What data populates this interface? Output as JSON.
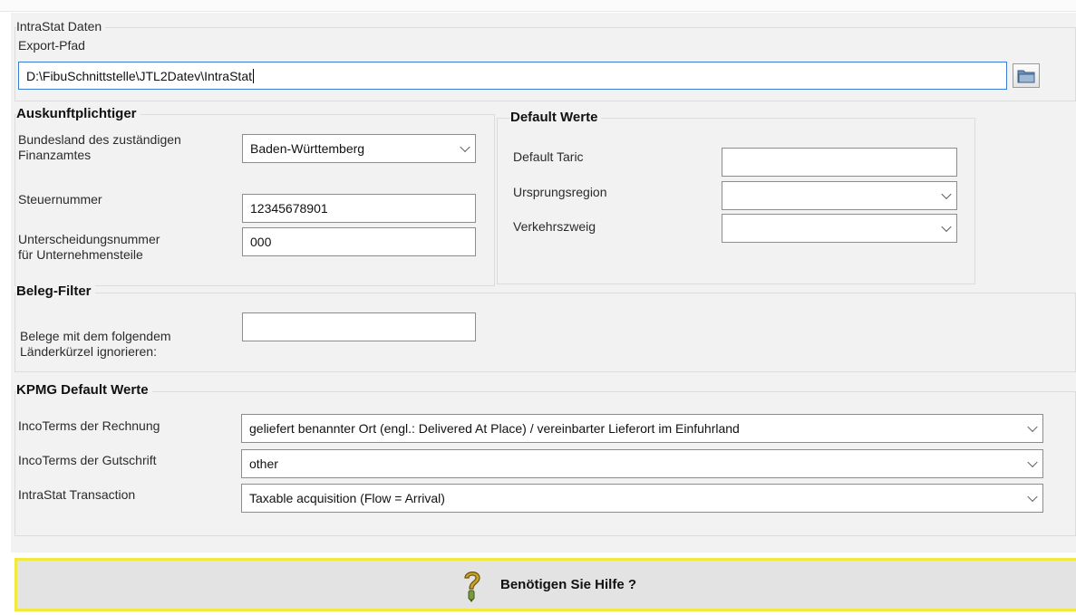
{
  "intrastat": {
    "title": "IntraStat Daten",
    "export_label": "Export-Pfad",
    "export_path": "D:\\FibuSchnittstelle\\JTL2Datev\\IntraStat"
  },
  "auskunft": {
    "title": "Auskunftplichtiger",
    "bundesland_label1": "Bundesland des zuständigen",
    "bundesland_label2": "Finanzamtes",
    "bundesland_value": "Baden-Württemberg",
    "steuernummer_label": "Steuernummer",
    "steuernummer_value": "12345678901",
    "unterscheidung_label1": "Unterscheidungsnummer",
    "unterscheidung_label2": "für Unternehmensteile",
    "unterscheidung_value": "000"
  },
  "default_werte": {
    "title": "Default Werte",
    "taric_label": "Default Taric",
    "taric_value": "",
    "ursprung_label": "Ursprungsregion",
    "ursprung_value": "",
    "verkehr_label": "Verkehrszweig",
    "verkehr_value": ""
  },
  "beleg_filter": {
    "title": "Beleg-Filter",
    "label1": "Belege mit dem folgendem",
    "label2": "Länderkürzel ignorieren:",
    "value": ""
  },
  "kpmg": {
    "title": "KPMG Default Werte",
    "rechnung_label": "IncoTerms der Rechnung",
    "rechnung_value": "geliefert benannter Ort (engl.: Delivered At Place) / vereinbarter Lieferort im Einfuhrland",
    "gutschrift_label": "IncoTerms der Gutschrift",
    "gutschrift_value": "other",
    "transaction_label": "IntraStat Transaction",
    "transaction_value": "Taxable acquisition (Flow = Arrival)"
  },
  "help_button": {
    "label": "Benötigen Sie Hilfe ?"
  },
  "icons": {
    "folder": "folder-icon",
    "help": "help-question-icon",
    "dropdown": "chevron-down-icon"
  }
}
